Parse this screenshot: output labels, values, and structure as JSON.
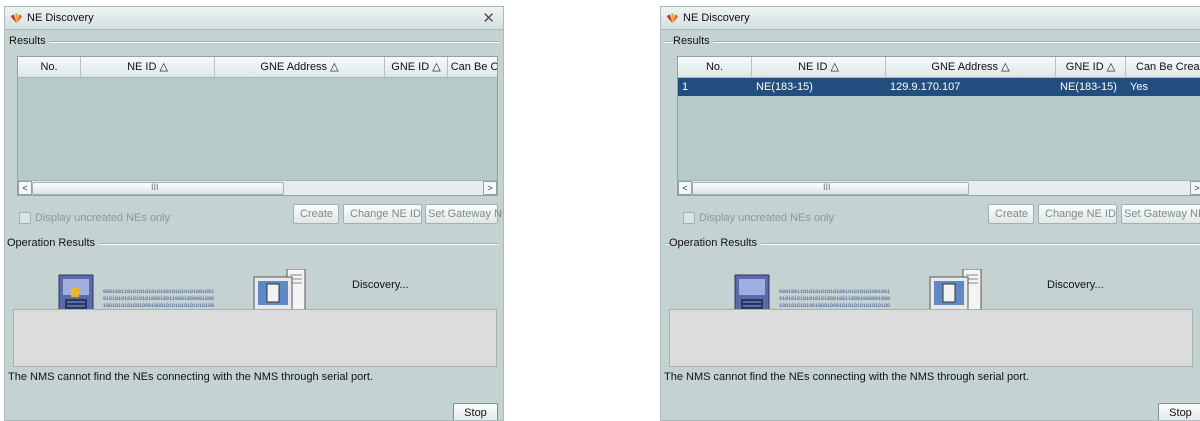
{
  "dialogs": [
    {
      "title": "NE Discovery",
      "results_label": "Results",
      "columns": [
        "No.",
        "NE ID △",
        "GNE Address △",
        "GNE ID △",
        "Can Be Crea"
      ],
      "rows": [],
      "scroll_grip": "III",
      "checkbox_label": "Display uncreated NEs only",
      "buttons": {
        "create": "Create",
        "change_ne_id": "Change NE ID",
        "set_gateway_ne": "Set Gateway NE",
        "stop": "Stop"
      },
      "operation_results_label": "Operation Results",
      "status_text": "Discovery...",
      "message": "The NMS cannot find the NEs connecting with the NMS through serial port."
    },
    {
      "title": "NE Discovery",
      "results_label": "Results",
      "columns": [
        "No.",
        "NE ID △",
        "GNE Address △",
        "GNE ID △",
        "Can Be Crea"
      ],
      "rows": [
        [
          "1",
          "NE(183-15)",
          "129.9.170.107",
          "NE(183-15)",
          "Yes"
        ]
      ],
      "scroll_grip": "III",
      "checkbox_label": "Display uncreated NEs only",
      "buttons": {
        "create": "Create",
        "change_ne_id": "Change NE ID",
        "set_gateway_ne": "Set Gateway NE",
        "stop": "Stop"
      },
      "operation_results_label": "Operation Results",
      "status_text": "Discovery...",
      "message": "The NMS cannot find the NEs connecting with the NMS through serial port."
    }
  ],
  "icons": {
    "close": "close-icon",
    "app": "huawei-logo-icon",
    "checkbox": "checkbox-icon"
  },
  "colors": {
    "dialog_bg": "#c4d3d2",
    "selection": "#214e7e",
    "log_bg": "#dcdcdc"
  }
}
